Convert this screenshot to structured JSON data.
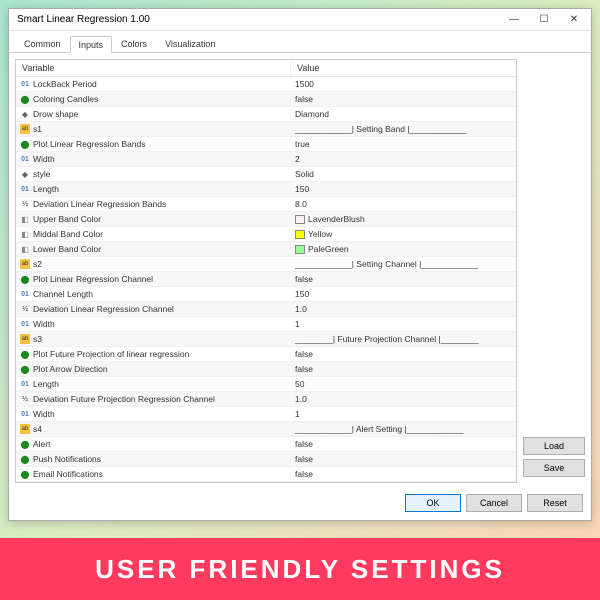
{
  "window": {
    "title": "Smart Linear Regression 1.00"
  },
  "tabs": [
    "Common",
    "Inputs",
    "Colors",
    "Visualization"
  ],
  "active_tab": "Inputs",
  "headers": {
    "variable": "Variable",
    "value": "Value"
  },
  "rows": [
    {
      "icon": "num",
      "var": "LockBack Period",
      "val": "1500"
    },
    {
      "icon": "bool",
      "var": "Coloring Candles",
      "val": "false"
    },
    {
      "icon": "shape",
      "var": "Drow shape",
      "val": "Diamond"
    },
    {
      "icon": "ab",
      "var": "s1",
      "val": "____________| Setting Band |____________"
    },
    {
      "icon": "bool",
      "var": "Plot Linear Regression Bands",
      "val": "true"
    },
    {
      "icon": "num",
      "var": "Width",
      "val": "2"
    },
    {
      "icon": "shape",
      "var": "style",
      "val": "Solid"
    },
    {
      "icon": "num",
      "var": "Length",
      "val": "150"
    },
    {
      "icon": "frac",
      "var": "Deviation Linear Regression Bands",
      "val": "8.0"
    },
    {
      "icon": "color",
      "var": "Upper Band Color",
      "val": "LavenderBlush",
      "swatch": "#fff0f5"
    },
    {
      "icon": "color",
      "var": "Middal Band Color",
      "val": "Yellow",
      "swatch": "#ffff00"
    },
    {
      "icon": "color",
      "var": "Lower Band Color",
      "val": "PaleGreen",
      "swatch": "#98fb98"
    },
    {
      "icon": "ab",
      "var": "s2",
      "val": "____________| Setting Channel |____________"
    },
    {
      "icon": "bool",
      "var": "Plot Linear Regression Channel",
      "val": "false"
    },
    {
      "icon": "num",
      "var": "Channel Length",
      "val": "150"
    },
    {
      "icon": "frac",
      "var": "Deviation Linear Regression Channel",
      "val": "1.0"
    },
    {
      "icon": "num",
      "var": "Width",
      "val": "1"
    },
    {
      "icon": "ab",
      "var": "s3",
      "val": "________| Future Projection Channel |________"
    },
    {
      "icon": "bool",
      "var": "Plot Future Projection of linear regression",
      "val": "false"
    },
    {
      "icon": "bool",
      "var": "Plot Arrow Direction",
      "val": "false"
    },
    {
      "icon": "num",
      "var": "Length",
      "val": "50"
    },
    {
      "icon": "frac",
      "var": "Deviation Future Projection Regression Channel",
      "val": "1.0"
    },
    {
      "icon": "num",
      "var": "Width",
      "val": "1"
    },
    {
      "icon": "ab",
      "var": "s4",
      "val": "____________| Alert Setting |____________"
    },
    {
      "icon": "bool",
      "var": "Alert",
      "val": "false"
    },
    {
      "icon": "bool",
      "var": "Push Notifications",
      "val": "false"
    },
    {
      "icon": "bool",
      "var": "Email Notifications",
      "val": "false"
    }
  ],
  "buttons": {
    "load": "Load",
    "save": "Save",
    "ok": "OK",
    "cancel": "Cancel",
    "reset": "Reset"
  },
  "banner": "USER FRIENDLY SETTINGS"
}
